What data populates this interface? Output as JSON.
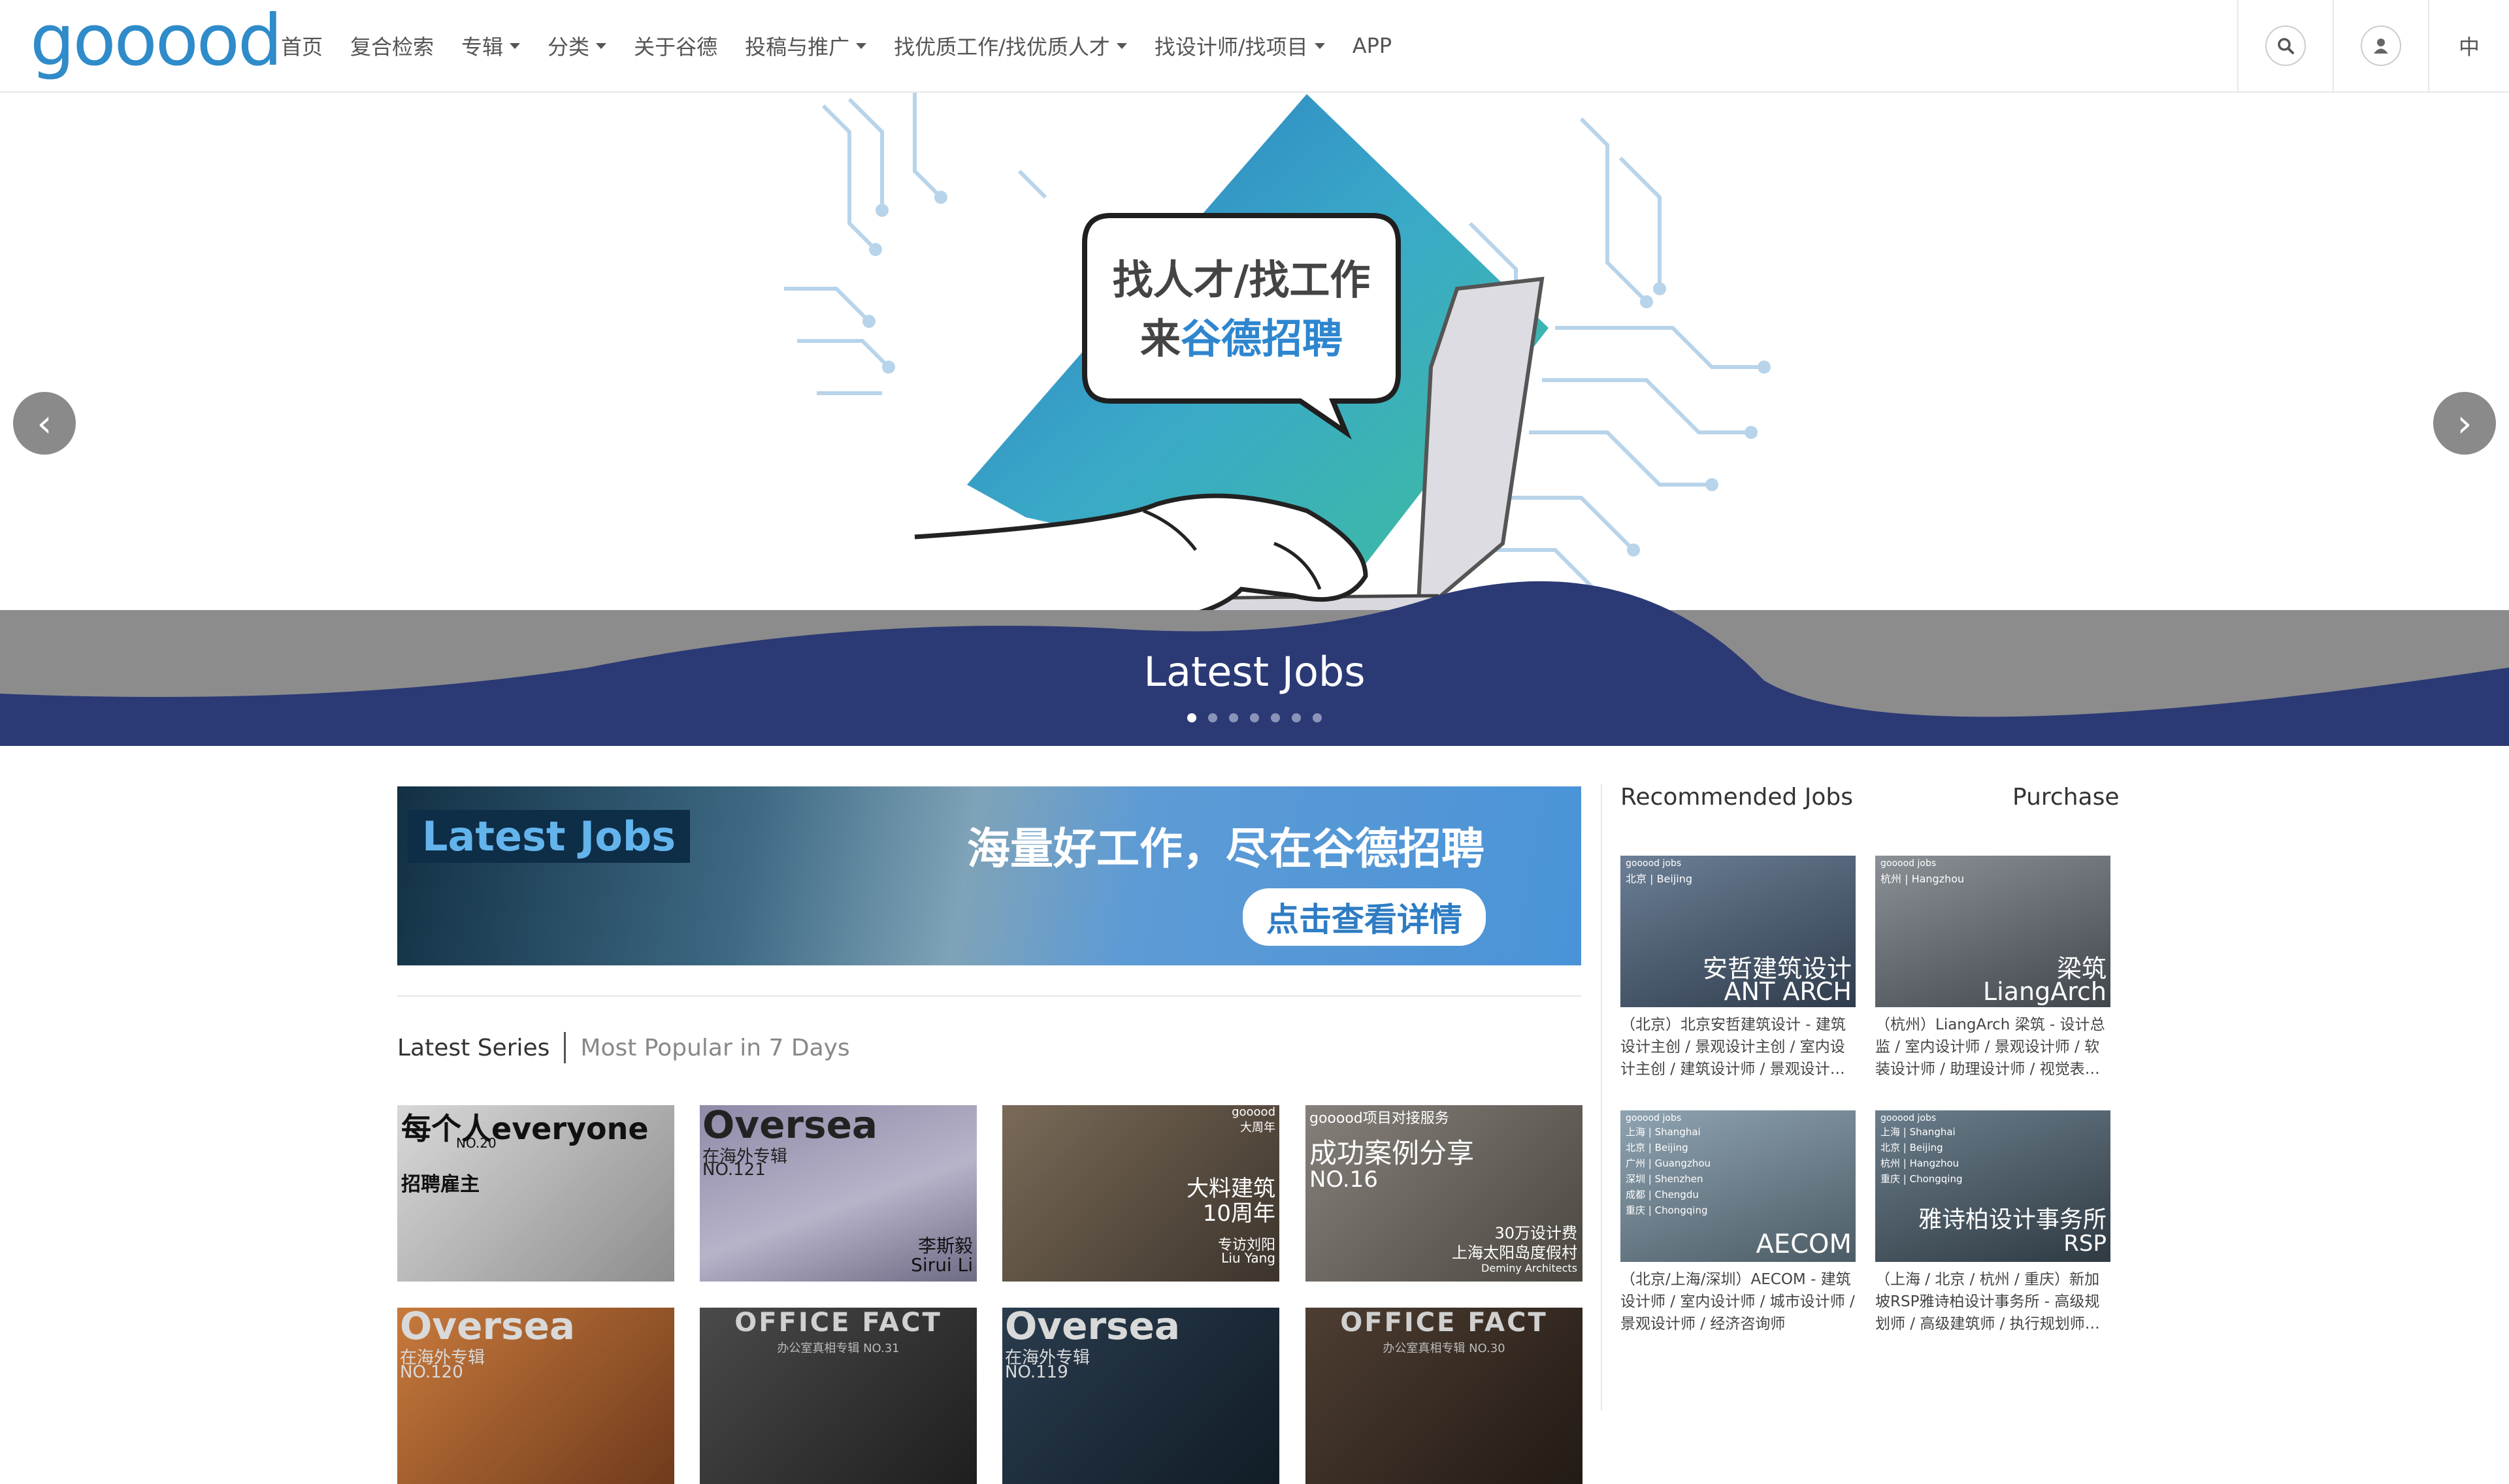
{
  "header": {
    "logo": "gooood",
    "nav": [
      {
        "label": "首页",
        "dropdown": false
      },
      {
        "label": "复合检索",
        "dropdown": false
      },
      {
        "label": "专辑",
        "dropdown": true
      },
      {
        "label": "分类",
        "dropdown": true
      },
      {
        "label": "关于谷德",
        "dropdown": false
      },
      {
        "label": "投稿与推广",
        "dropdown": true
      },
      {
        "label": "找优质工作/找优质人才",
        "dropdown": true
      },
      {
        "label": "找设计师/找项目",
        "dropdown": true
      },
      {
        "label": "APP",
        "dropdown": false
      }
    ],
    "search_icon": "search-icon",
    "user_icon": "user-icon",
    "lang": "中"
  },
  "hero": {
    "bubble_line1": "找人才/找工作",
    "bubble_line2_prefix": "来",
    "bubble_line2_highlight": "谷德招聘",
    "caption": "Latest Jobs",
    "slide_count": 7,
    "active_slide": 1,
    "prev_icon": "chevron-left-icon",
    "next_icon": "chevron-right-icon",
    "colors": {
      "band_gray": "#8c8c8c",
      "band_navy": "#2b3a75",
      "triangle": "#3fa5c9"
    }
  },
  "banner": {
    "tag": "Latest Jobs",
    "slogan": "海量好工作，尽在谷德招聘",
    "button": "点击查看详情"
  },
  "tabs": {
    "active": "Latest Series",
    "other": "Most Popular in 7 Days"
  },
  "series": [
    {
      "t1": "每个人everyone",
      "t2": "NO.20",
      "t3": "招聘雇主",
      "bg": "#b9b9b9"
    },
    {
      "t1": "Oversea",
      "t2": "在海外专辑",
      "t3": "NO.121",
      "t4": "李斯毅",
      "t5": "Sirui Li",
      "bg": "#8a86a6"
    },
    {
      "t1": "gooood",
      "t2": "大周年",
      "t3": "大料建筑",
      "t4": "10周年",
      "t5": "专访刘阳",
      "t6": "Liu Yang",
      "bg": "#5e5448"
    },
    {
      "t1": "gooood项目对接服务",
      "t2": "成功案例分享",
      "t3": "NO.16",
      "t4": "30万设计费",
      "t5": "上海太阳岛度假村",
      "t6": "Deminy Architects",
      "bg": "#6f6a62"
    },
    {
      "t1": "Oversea",
      "t2": "在海外专辑",
      "t3": "NO.120",
      "bg": "#b0602e"
    },
    {
      "t1": "OFFICE FACT",
      "t2": "办公室真相专辑 NO.31",
      "bg": "#3a3a3a"
    },
    {
      "t1": "Oversea",
      "t2": "在海外专辑",
      "t3": "NO.119",
      "bg": "#1f2f3e"
    },
    {
      "t1": "OFFICE FACT",
      "t2": "办公室真相专辑 NO.30",
      "bg": "#3b2f27"
    }
  ],
  "sidebar": {
    "title": "Recommended Jobs",
    "purchase": "Purchase",
    "jobs": [
      {
        "tag": "gooood jobs",
        "city": "北京 | Beijing",
        "name_cn": "安哲建筑设计",
        "name_en": "ANT ARCH",
        "desc": "（北京）北京安哲建筑设计 - 建筑设计主创 / 景观设计主创 / 室内设计主创 / 建筑设计师 / 景观设计…",
        "bg": "#4a5a6e"
      },
      {
        "tag": "gooood jobs",
        "city": "杭州 | Hangzhou",
        "name_cn": "梁筑",
        "name_en": "LiangArch",
        "desc": "（杭州）LiangArch 梁筑 - 设计总监 / 室内设计师 / 景观设计师 / 软装设计师 / 助理设计师 / 视觉表…",
        "bg": "#6b7278"
      },
      {
        "tag": "gooood jobs",
        "city": "上海 | Shanghai",
        "city2": "北京 | Beijing",
        "city3": "广州 | Guangzhou",
        "city4": "深圳 | Shenzhen",
        "city5": "成都 | Chengdu",
        "city6": "重庆 | Chongqing",
        "name_en": "AECOM",
        "desc": "（北京/上海/深圳）AECOM - 建筑设计师 / 室内设计师 / 城市设计师 / 景观设计师 / 经济咨询师",
        "bg": "#6f8494"
      },
      {
        "tag": "gooood jobs",
        "city": "上海 | Shanghai",
        "city2": "北京 | Beijing",
        "city3": "杭州 | Hangzhou",
        "city4": "重庆 | Chongqing",
        "name_cn": "雅诗柏设计事务所",
        "name_en": "RSP",
        "desc": "（上海 / 北京 / 杭州 / 重庆）新加坡RSP雅诗柏设计事务所 - 高级规划师 / 高级建筑师 / 执行规划师…",
        "bg": "#4d5d6a"
      }
    ]
  }
}
